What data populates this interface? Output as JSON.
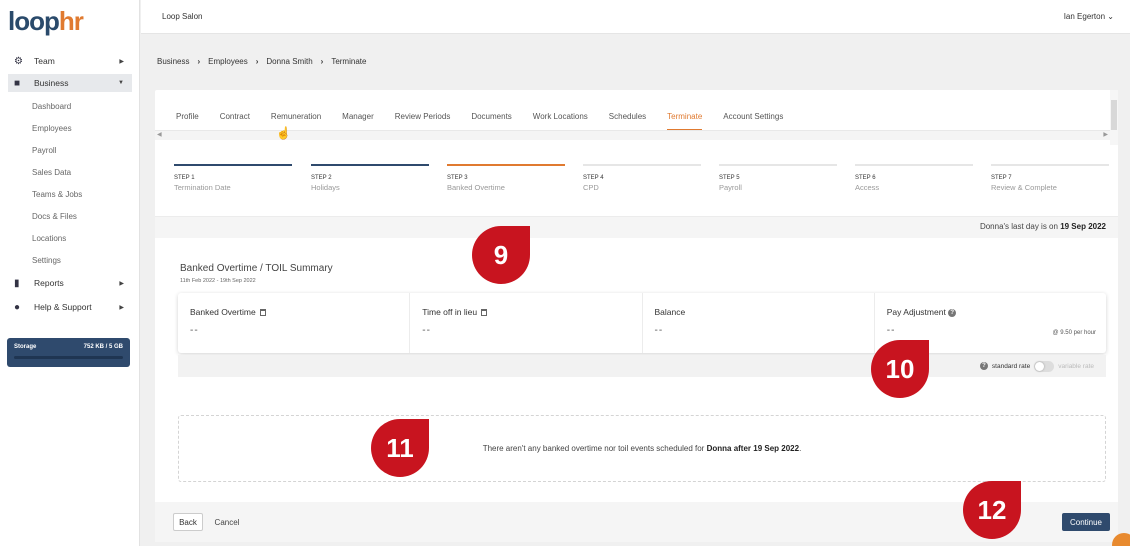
{
  "app": {
    "logo_main": "loop",
    "logo_accent": "hr"
  },
  "sidebar": {
    "main": [
      {
        "label": "Team",
        "icon": "team-icon"
      },
      {
        "label": "Business",
        "icon": "business-icon"
      },
      {
        "label": "Reports",
        "icon": "reports-icon"
      },
      {
        "label": "Help & Support",
        "icon": "help-icon"
      }
    ],
    "business_sub": [
      "Dashboard",
      "Employees",
      "Payroll",
      "Sales Data",
      "Teams & Jobs",
      "Docs & Files",
      "Locations",
      "Settings"
    ],
    "storage": {
      "label": "Storage",
      "value": "752 KB / 5 GB"
    }
  },
  "header": {
    "salon": "Loop Salon",
    "user": "Ian Egerton"
  },
  "breadcrumb": [
    "Business",
    "Employees",
    "Donna Smith",
    "Terminate"
  ],
  "tabs": [
    "Profile",
    "Contract",
    "Remuneration",
    "Manager",
    "Review Periods",
    "Documents",
    "Work Locations",
    "Schedules",
    "Terminate",
    "Account Settings"
  ],
  "steps": [
    {
      "num": "STEP 1",
      "title": "Termination Date"
    },
    {
      "num": "STEP 2",
      "title": "Holidays"
    },
    {
      "num": "STEP 3",
      "title": "Banked Overtime"
    },
    {
      "num": "STEP 4",
      "title": "CPD"
    },
    {
      "num": "STEP 5",
      "title": "Payroll"
    },
    {
      "num": "STEP 6",
      "title": "Access"
    },
    {
      "num": "STEP 7",
      "title": "Review & Complete"
    }
  ],
  "last_day": {
    "prefix": "Donna's last day is on",
    "date": "19 Sep 2022"
  },
  "summary": {
    "title": "Banked Overtime / TOIL Summary",
    "range": "11th Feb 2022 - 19th Sep 2022",
    "cells": [
      {
        "label": "Banked Overtime",
        "value": "--"
      },
      {
        "label": "Time off in lieu",
        "value": "--"
      },
      {
        "label": "Balance",
        "value": "--"
      },
      {
        "label": "Pay Adjustment",
        "value": "--",
        "rate": "@ 9.50 per hour"
      }
    ]
  },
  "rate_toggle": {
    "standard": "standard rate",
    "variable": "variable rate"
  },
  "empty_msg": {
    "text": "There aren't any banked overtime nor toil events scheduled for",
    "name": "Donna after 19 Sep 2022",
    "end": "."
  },
  "footer": {
    "back": "Back",
    "cancel": "Cancel",
    "continue": "Continue"
  },
  "markers": [
    "9",
    "10",
    "11",
    "12"
  ],
  "colors": {
    "navy": "#2f4a6d",
    "accent": "#e07a30",
    "marker": "#c8141f"
  }
}
